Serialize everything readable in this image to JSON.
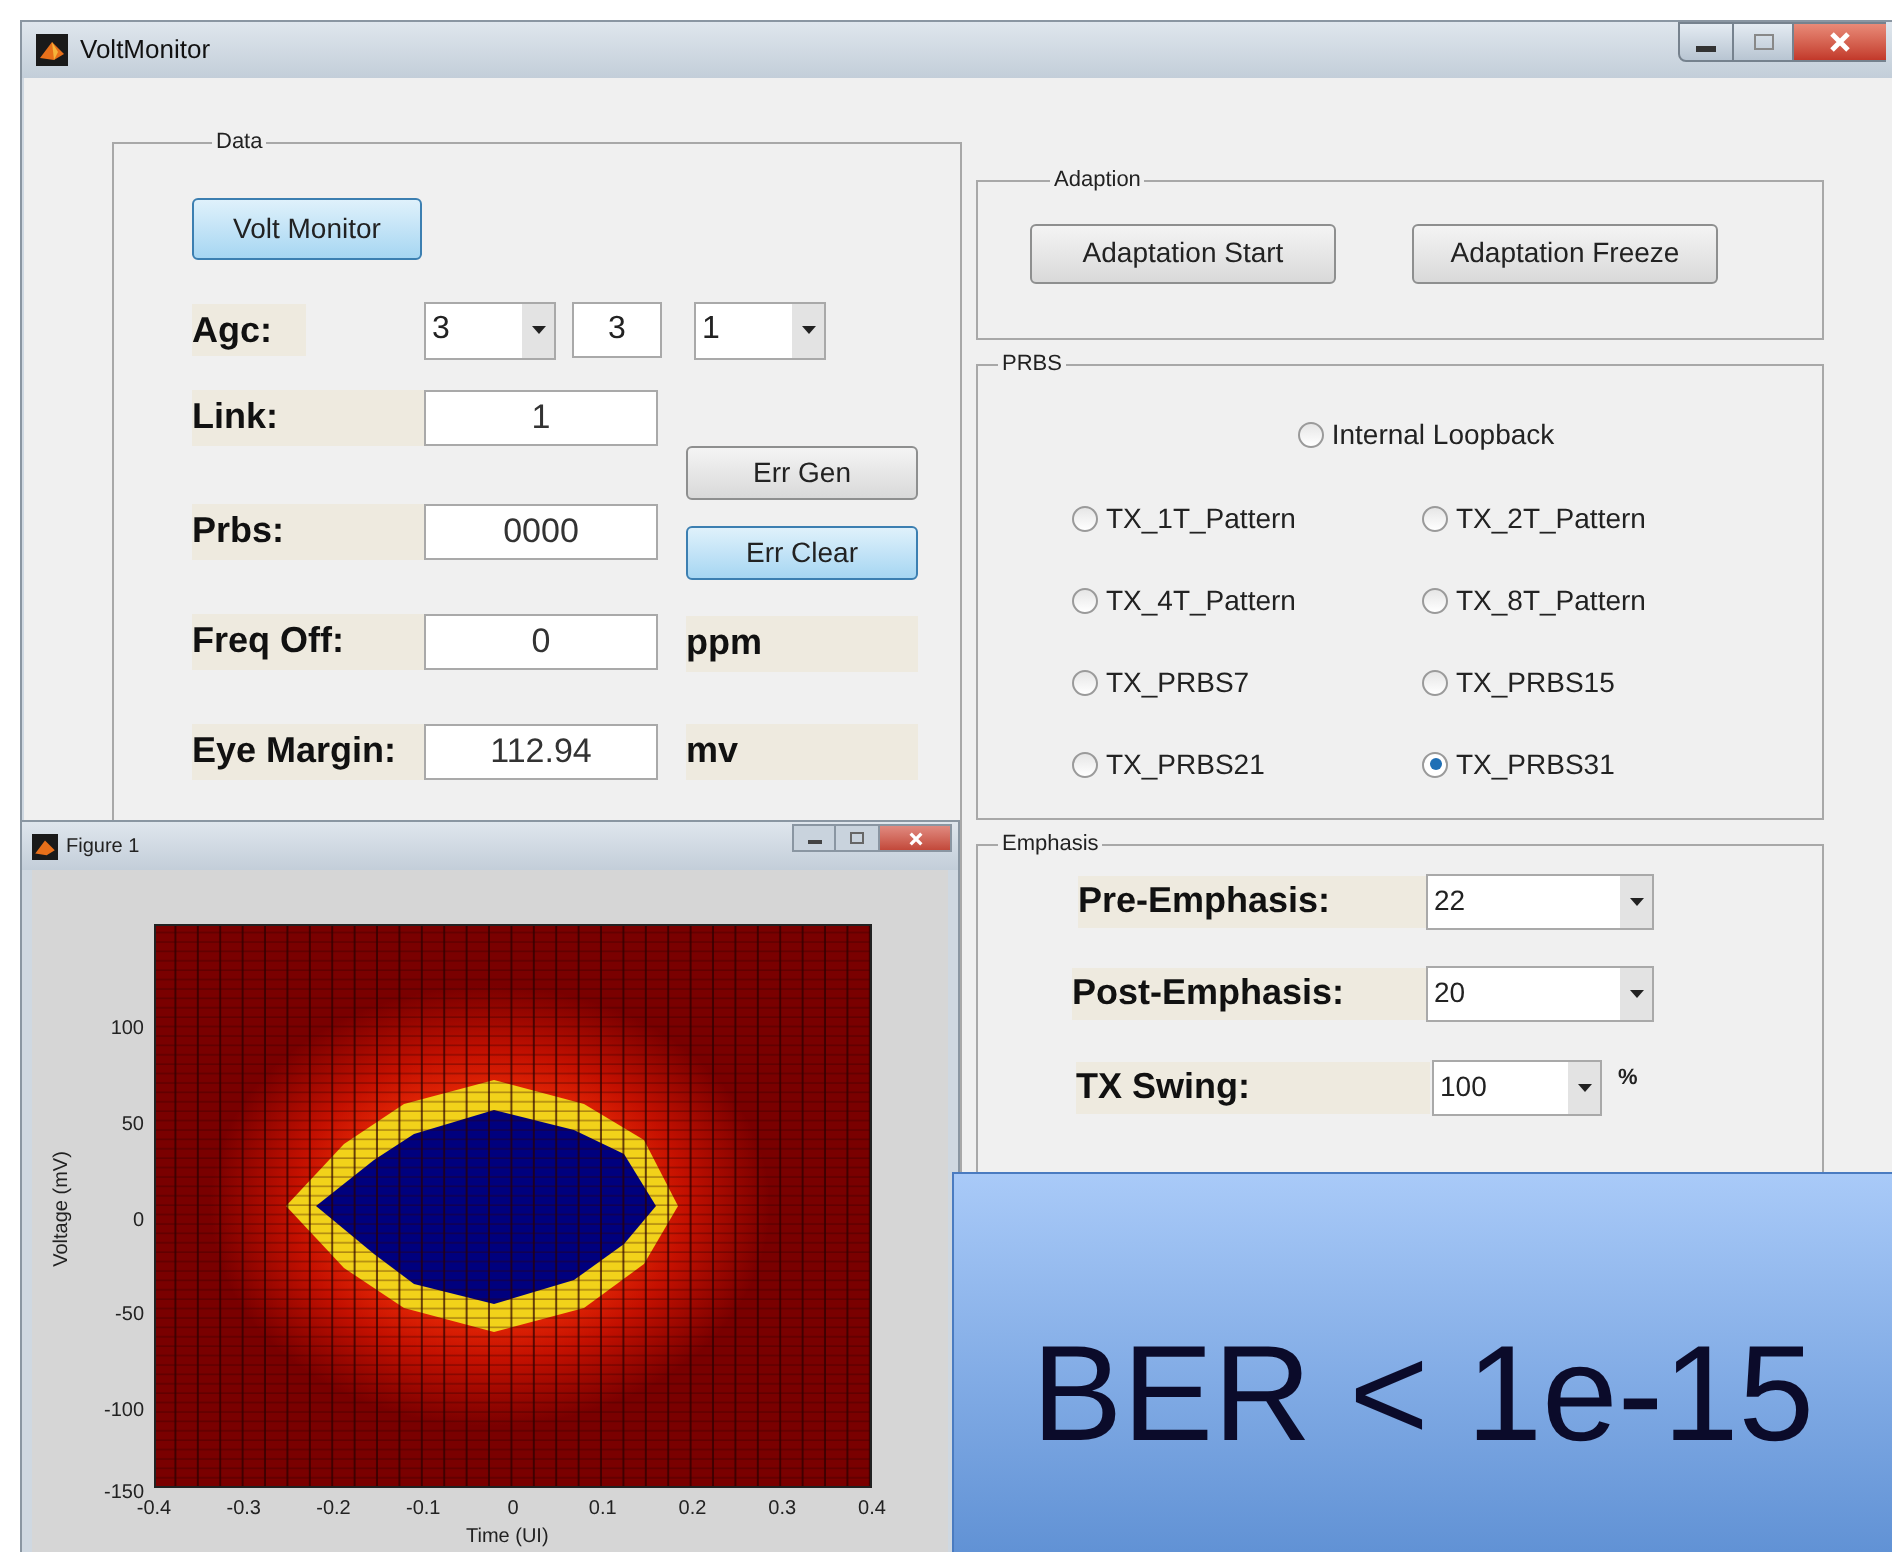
{
  "window": {
    "title": "VoltMonitor"
  },
  "data_panel": {
    "legend": "Data",
    "top_button": {
      "label": "Volt Monitor",
      "highlighted": true
    },
    "agc": {
      "label": "Agc:",
      "dropdown_1": "3",
      "field": "3",
      "dropdown_2": "1"
    },
    "rows": [
      {
        "label": "Link:",
        "value": "1"
      },
      {
        "label": "Prbs:",
        "value": "0000"
      },
      {
        "label": "Freq Off:",
        "value": "0"
      },
      {
        "label": "Eye Margin:",
        "value": "112.94"
      }
    ],
    "buttons": [
      {
        "label": "Err Gen",
        "highlighted": false
      },
      {
        "label": "Err Clear",
        "highlighted": true
      }
    ],
    "units": [
      "ppm",
      "mv"
    ]
  },
  "adaption_panel": {
    "legend": "Adaption",
    "buttons": [
      "Adaptation Start",
      "Adaptation Freeze"
    ]
  },
  "prbs_panel": {
    "legend": "PRBS",
    "loopback": {
      "label": "Internal Loopback",
      "selected": false
    },
    "patterns": [
      {
        "label": "TX_1T_Pattern",
        "selected": false
      },
      {
        "label": "TX_2T_Pattern",
        "selected": false
      },
      {
        "label": "TX_4T_Pattern",
        "selected": false
      },
      {
        "label": "TX_8T_Pattern",
        "selected": false
      },
      {
        "label": "TX_PRBS7",
        "selected": false
      },
      {
        "label": "TX_PRBS15",
        "selected": false
      },
      {
        "label": "TX_PRBS21",
        "selected": false
      },
      {
        "label": "TX_PRBS31",
        "selected": true
      }
    ]
  },
  "emphasis_panel": {
    "legend": "Emphasis",
    "rows": [
      {
        "label": "Pre-Emphasis:",
        "value": "22"
      },
      {
        "label": "Post-Emphasis:",
        "value": "20"
      },
      {
        "label": "TX Swing:",
        "value": "100",
        "unit": "%"
      }
    ]
  },
  "figure_window": {
    "title": "Figure 1",
    "xlabel": "Time (UI)",
    "ylabel": "Voltage (mV)",
    "xticks": [
      "-0.4",
      "-0.3",
      "-0.2",
      "-0.1",
      "0",
      "0.1",
      "0.2",
      "0.3",
      "0.4"
    ],
    "yticks": [
      "100",
      "50",
      "0",
      "-50",
      "-100",
      "-150"
    ]
  },
  "callout": {
    "text": "BER < 1e-15"
  }
}
